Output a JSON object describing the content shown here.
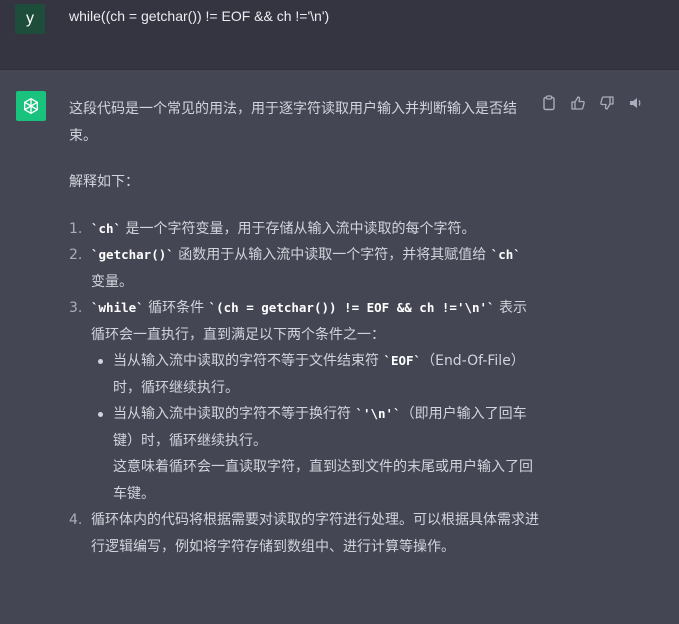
{
  "user": {
    "avatar_letter": "y",
    "avatar_color": "#1f4d3c",
    "message": "while((ch = getchar()) != EOF && ch !='\\n')"
  },
  "assistant": {
    "avatar_icon": "openai-logo-icon",
    "avatar_color": "#19c37d",
    "actions": [
      "clipboard-icon",
      "thumbs-up-icon",
      "thumbs-down-icon",
      "speaker-icon"
    ],
    "intro": "这段代码是一个常见的用法，用于逐字符读取用户输入并判断输入是否结束。",
    "explain_heading": "解释如下：",
    "items": [
      {
        "num": "1.",
        "code1": "`ch`",
        "text1": " 是一个字符变量，用于存储从输入流中读取的每个字符。"
      },
      {
        "num": "2.",
        "code1": "`getchar()`",
        "text1": " 函数用于从输入流中读取一个字符，并将其赋值给 ",
        "code2": "`ch`",
        "text2": " 变量。"
      },
      {
        "num": "3.",
        "code1": "`while`",
        "text1": " 循环条件 ",
        "code2": "`(ch = getchar()) != EOF && ch !='\\n'`",
        "text2": " 表示循环会一直执行，直到满足以下两个条件之一：",
        "bullets": [
          {
            "t1": "当从输入流中读取的字符不等于文件结束符 ",
            "c": "`EOF`",
            "t2": "（End-Of-File）时，循环继续执行。"
          },
          {
            "t1": "当从输入流中读取的字符不等于换行符 ",
            "c": "`'\\n'`",
            "t2": "（即用户输入了回车键）时，循环继续执行。",
            "extra": "这意味着循环会一直读取字符，直到达到文件的末尾或用户输入了回车键。"
          }
        ]
      },
      {
        "num": "4.",
        "text1": "循环体内的代码将根据需要对读取的字符进行处理。可以根据具体需求进行逻辑编写，例如将字符存储到数组中、进行计算等操作。"
      }
    ]
  },
  "colors": {
    "user_bg": "#343541",
    "assistant_bg": "#444654",
    "text": "#d1d5db",
    "list_number": "#acacbe"
  }
}
